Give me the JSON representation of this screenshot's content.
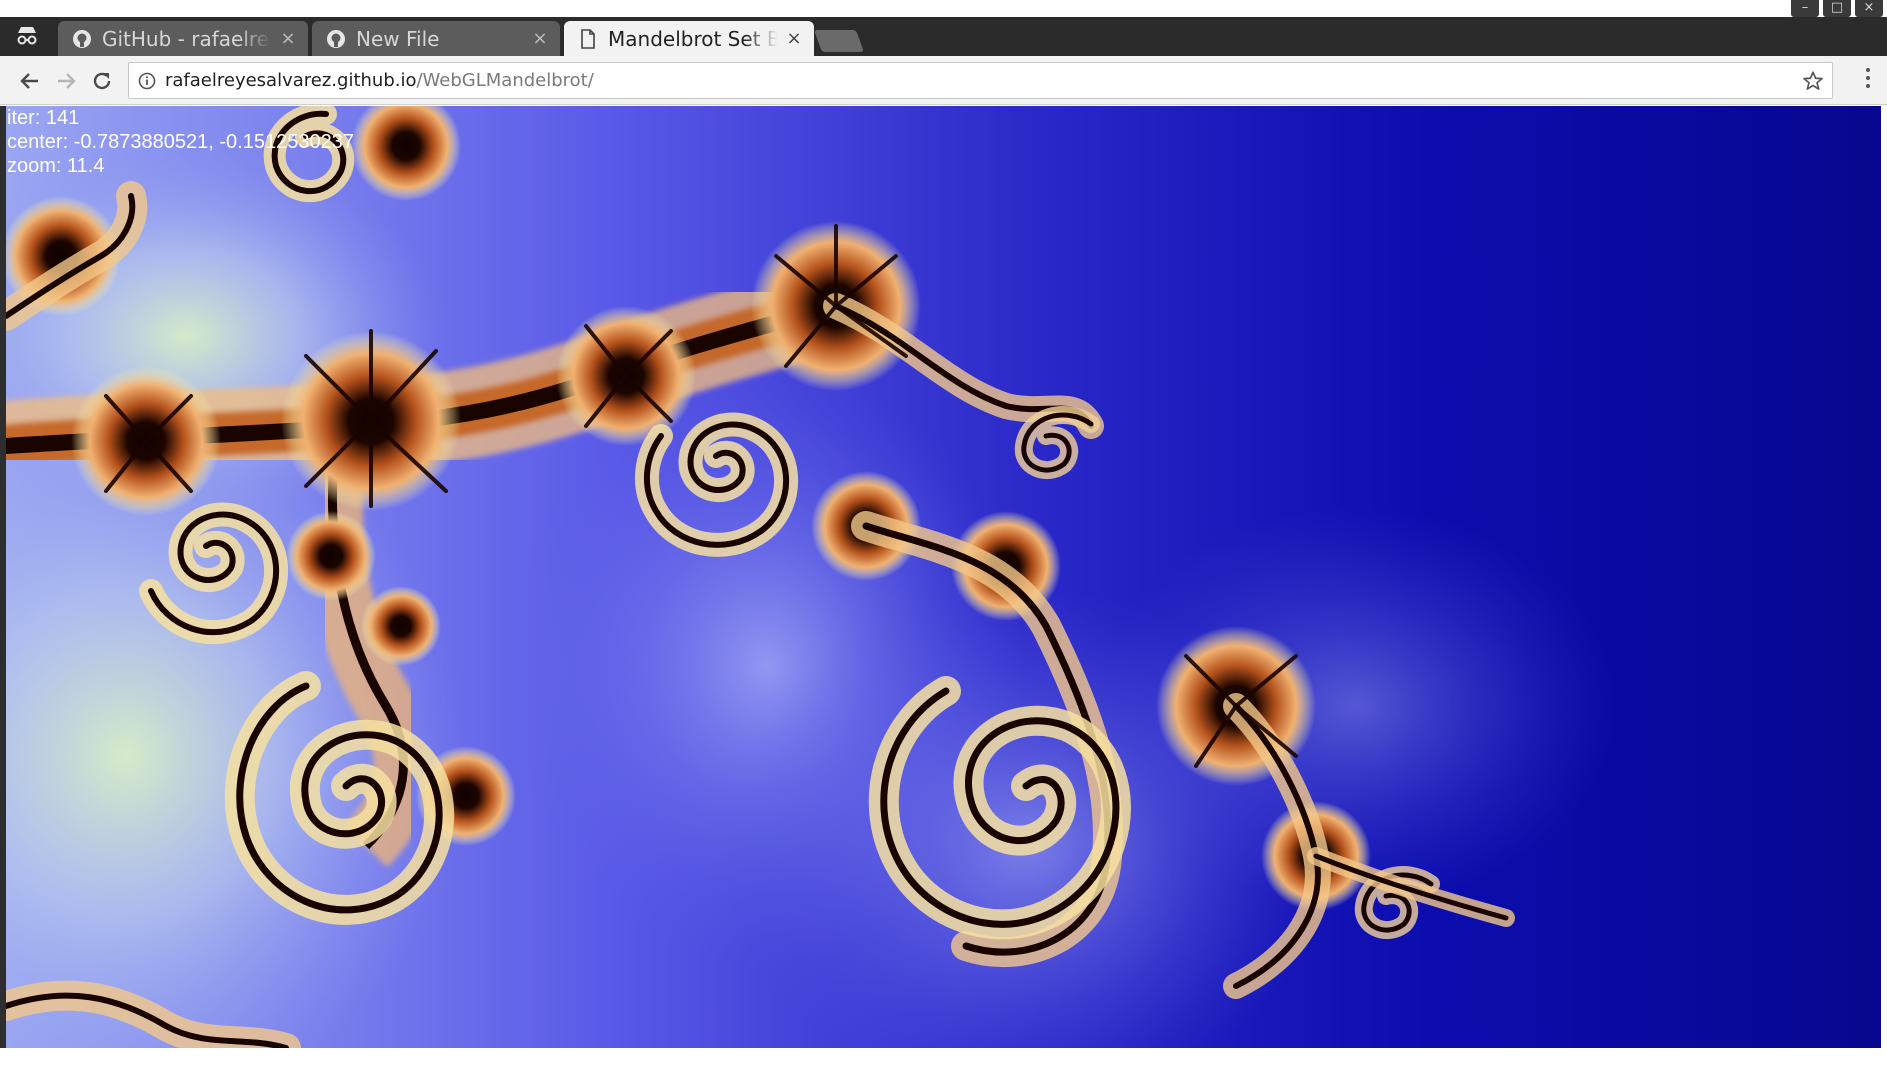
{
  "window": {
    "controls": [
      "–",
      "□",
      "×"
    ]
  },
  "tabs": [
    {
      "title": "GitHub - rafaelreyesalvarez",
      "favicon": "github-icon",
      "active": false,
      "close": "×"
    },
    {
      "title": "New File",
      "favicon": "github-icon",
      "active": false,
      "close": "×"
    },
    {
      "title": "Mandelbrot Set Browser",
      "favicon": "page-icon",
      "active": true,
      "close": "×"
    }
  ],
  "toolbar": {
    "url_host": "rafaelreyesalvarez.github.io",
    "url_path": "/WebGLMandelbrot/",
    "icons": [
      "back-arrow-icon",
      "forward-arrow-icon",
      "reload-icon",
      "info-icon",
      "bookmark-star-icon",
      "menu-icon"
    ]
  },
  "overlay": {
    "iter_line": "iter: 141",
    "center_line": "center: -0.7873880521, -0.1512530237",
    "zoom_line": "zoom: 11.4"
  },
  "colors": {
    "deep_blue": "#0a0a9e",
    "mid_blue": "#4646e0",
    "pale_blue": "#9aa6f2",
    "cream": "#f6f7b4",
    "orange": "#e58a45",
    "dark": "#1a0400"
  }
}
